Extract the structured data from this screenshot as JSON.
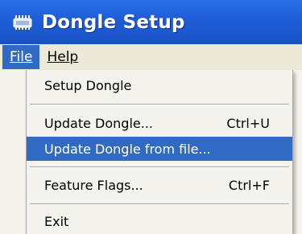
{
  "window": {
    "title": "Dongle Setup"
  },
  "menubar": {
    "items": [
      {
        "label": "File",
        "active": true
      },
      {
        "label": "Help",
        "active": false
      }
    ]
  },
  "file_menu": {
    "items": [
      {
        "label": "Setup Dongle",
        "shortcut": ""
      },
      {
        "label": "Update Dongle...",
        "shortcut": "Ctrl+U"
      },
      {
        "label": "Update Dongle from file...",
        "shortcut": "",
        "highlighted": true
      },
      {
        "label": "Feature Flags...",
        "shortcut": "Ctrl+F"
      },
      {
        "label": "Exit",
        "shortcut": ""
      }
    ]
  },
  "colors": {
    "titlebar": "#1f5ed8",
    "highlight": "#316ac5",
    "menubar": "#ece9d8"
  },
  "icons": {
    "title_icon": "dongle-chip-icon"
  }
}
